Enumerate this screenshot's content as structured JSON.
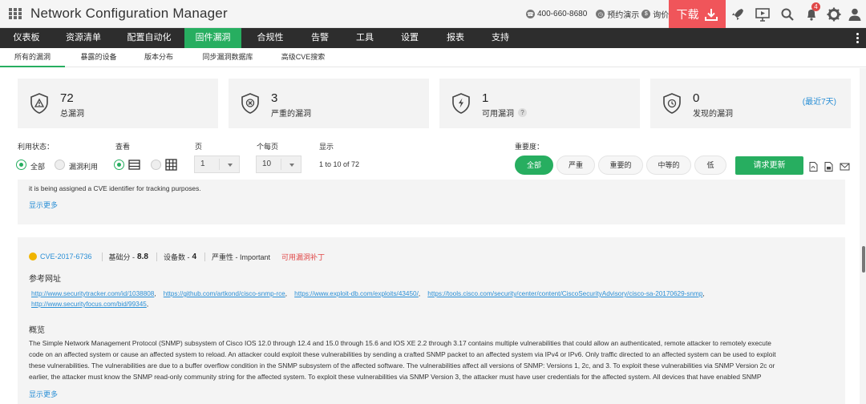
{
  "app": {
    "title": "Network Configuration Manager",
    "phone": "400-660-8680",
    "demo_label": "预约演示",
    "quote_label": "询价",
    "download_label": "下载",
    "notification_count": "4",
    "accent_color": "#27ae60",
    "download_color": "#f0555a"
  },
  "main_nav": [
    {
      "label": "仪表板",
      "active": false
    },
    {
      "label": "资源清单",
      "active": false
    },
    {
      "label": "配置自动化",
      "active": false
    },
    {
      "label": "固件漏洞",
      "active": true
    },
    {
      "label": "合规性",
      "active": false
    },
    {
      "label": "告警",
      "active": false
    },
    {
      "label": "工具",
      "active": false
    },
    {
      "label": "设置",
      "active": false
    },
    {
      "label": "报表",
      "active": false
    },
    {
      "label": "支持",
      "active": false
    }
  ],
  "sub_nav": [
    {
      "label": "所有的漏洞",
      "active": true
    },
    {
      "label": "暴露的设备",
      "active": false
    },
    {
      "label": "版本分布",
      "active": false
    },
    {
      "label": "同步漏洞数据库",
      "active": false
    },
    {
      "label": "高级CVE搜索",
      "active": false
    }
  ],
  "cards": [
    {
      "value": "72",
      "label": "总漏洞",
      "icon": "warning-shield-icon"
    },
    {
      "value": "3",
      "label": "严重的漏洞",
      "icon": "critical-shield-icon"
    },
    {
      "value": "1",
      "label": "可用漏洞",
      "icon": "exploit-shield-icon"
    },
    {
      "value": "0",
      "label": "发现的漏洞",
      "icon": "discovered-shield-icon",
      "recent": "(最近7天)"
    }
  ],
  "filters": {
    "exploit_status_label": "利用状态：",
    "all_label": "全部",
    "exploited_label": "漏洞利用",
    "view_label": "查看",
    "page_label": "页",
    "page_value": "1",
    "per_page_label": "个每页",
    "per_page_value": "10",
    "display_label": "显示",
    "display_value": "1 to 10 of 72",
    "severity_label": "重要度：",
    "severity_options": [
      "全部",
      "严重",
      "重要的",
      "中等的",
      "低"
    ],
    "request_update_label": "请求更新"
  },
  "entry1": {
    "text": "it is being assigned a CVE identifier for tracking purposes.",
    "more_label": "显示更多"
  },
  "entry2": {
    "cve_id": "CVE-2017-6736",
    "base_score_label": "基础分 -",
    "base_score": "8.8",
    "device_count_label": "设备数 -",
    "device_count": "4",
    "severity_text": "严重性 - Important",
    "patch_label": "可用漏洞补丁",
    "refs_title": "参考网址",
    "references": [
      "http://www.securitytracker.com/id/1038808",
      "https://github.com/artkond/cisco-snmp-rce",
      "https://www.exploit-db.com/exploits/43450/",
      "https://tools.cisco.com/security/center/content/CiscoSecurityAdvisory/cisco-sa-20170629-snmp",
      "http://www.securityfocus.com/bid/99345"
    ],
    "overview_title": "概览",
    "overview_lines": [
      "The Simple Network Management Protocol (SNMP) subsystem of Cisco IOS 12.0 through 12.4 and 15.0 through 15.6 and IOS XE 2.2 through 3.17 contains multiple vulnerabilities that could allow an authenticated, remote attacker to remotely execute",
      "code on an affected system or cause an affected system to reload. An attacker could exploit these vulnerabilities by sending a crafted SNMP packet to an affected system via IPv4 or IPv6. Only traffic directed to an affected system can be used to exploit",
      "these vulnerabilities. The vulnerabilities are due to a buffer overflow condition in the SNMP subsystem of the affected software. The vulnerabilities affect all versions of SNMP: Versions 1, 2c, and 3. To exploit these vulnerabilities via SNMP Version 2c or",
      "earlier, the attacker must know the SNMP read-only community string for the affected system. To exploit these vulnerabilities via SNMP Version 3, the attacker must have user credentials for the affected system. All devices that have enabled SNMP"
    ],
    "more_label": "显示更多"
  }
}
